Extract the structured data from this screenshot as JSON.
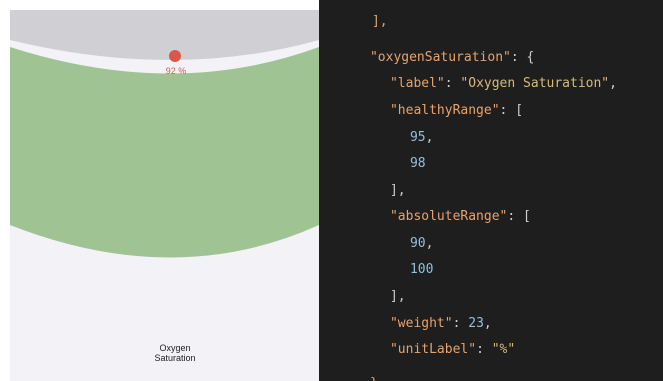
{
  "gauge": {
    "value_text": "92 %",
    "label": "Oxygen\nSaturation",
    "value": 92,
    "absolute_range": [
      90,
      100
    ],
    "healthy_range": [
      95,
      98
    ],
    "colors": {
      "background": "#f3f3f7",
      "top_zone": "#cfcfd4",
      "healthy_band": "#9fc393",
      "value_dot": "#d9584a",
      "value_text": "#d35a4a"
    }
  },
  "code": {
    "line_open_close": "],",
    "key_oxygen": "\"oxygenSaturation\"",
    "brace_open": ": {",
    "key_label": "\"label\"",
    "val_label": "\"Oxygen Saturation\"",
    "key_healthy": "\"healthyRange\"",
    "bracket_open": ": [",
    "num_95": "95",
    "num_98": "98",
    "bracket_close": "],",
    "key_absolute": "\"absoluteRange\"",
    "num_90": "90",
    "num_100": "100",
    "key_weight": "\"weight\"",
    "num_23": "23",
    "key_unit": "\"unitLabel\"",
    "val_unit": "\"%\"",
    "brace_close": "},",
    "colon": ": ",
    "comma": ","
  }
}
